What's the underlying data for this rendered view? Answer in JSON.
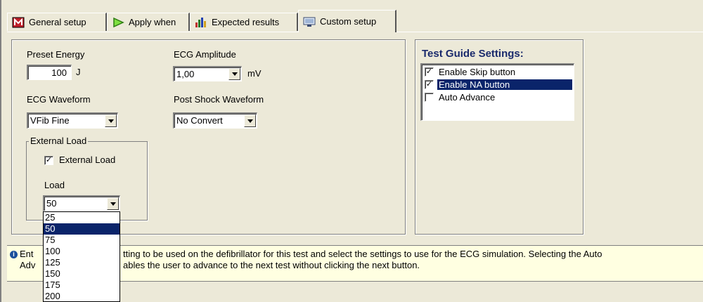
{
  "tabs": [
    {
      "label": "General setup",
      "icon": "general-setup-icon"
    },
    {
      "label": "Apply when",
      "icon": "play-arrow-icon"
    },
    {
      "label": "Expected results",
      "icon": "bar-chart-icon"
    },
    {
      "label": "Custom setup",
      "icon": "monitor-icon"
    }
  ],
  "active_tab": "Custom setup",
  "preset_energy": {
    "label": "Preset Energy",
    "value": "100",
    "unit": "J"
  },
  "ecg_amplitude": {
    "label": "ECG Amplitude",
    "value": "1,00",
    "unit": "mV"
  },
  "ecg_waveform": {
    "label": "ECG Waveform",
    "value": "VFib Fine"
  },
  "post_shock": {
    "label": "Post Shock Waveform",
    "value": "No Convert"
  },
  "external_load_group": {
    "title": "External Load",
    "checkbox_label": "External Load",
    "checked": true,
    "load_label": "Load",
    "load_value": "50",
    "load_options": [
      "25",
      "50",
      "75",
      "100",
      "125",
      "150",
      "175",
      "200"
    ],
    "selected_option": "50"
  },
  "test_guide": {
    "title": "Test Guide Settings:",
    "items": [
      {
        "label": "Enable Skip button",
        "checked": true
      },
      {
        "label": "Enable NA button",
        "checked": true
      },
      {
        "label": "Auto Advance",
        "checked": false
      }
    ]
  },
  "info": {
    "line1_a": "Ent",
    "line1_b": "tting to be used on the defibrillator for this test and select the settings to use for the ECG simulation. Selecting the Auto",
    "line2_a": "Adv",
    "line2_b": "ables the user to advance to the next test without clicking the next button."
  },
  "colors": {
    "selection": "#0a246a",
    "info_bg": "#ffffe1",
    "title_blue": "#1a2a6c"
  }
}
